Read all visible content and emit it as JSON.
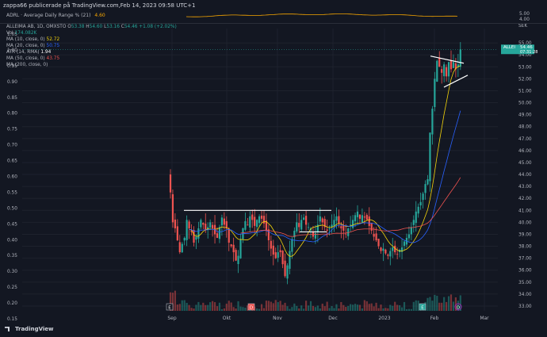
{
  "header": {
    "text": "zappa66 publicerade på TradingView.com,Feb 14, 2023 09:58 UTC+1"
  },
  "adr": {
    "label": "ADRL · Average Daily Range % (21)",
    "value": "4.60",
    "axis_ticks": [
      "5.00",
      "4.00"
    ]
  },
  "legend": {
    "title": "ALLEIMA AB, 1D, OMXSTO",
    "open_label": "O",
    "open": "53.38",
    "high_label": "H",
    "high": "54.60",
    "low_label": "L",
    "low": "53.16",
    "close_label": "C",
    "close": "54.46",
    "change": "+1.08 (+2.02%)",
    "vol_label": "Vol",
    "vol": "174.082K",
    "ma10_label": "MA (10, close, 0)",
    "ma10": "52.72",
    "ma20_label": "MA (20, close, 0)",
    "ma20": "50.75",
    "atr_label": "ATR (14, RMA)",
    "atr": "1.94",
    "ma50_label": "MA (50, close, 0)",
    "ma50": "43.75",
    "ma200_label": "MA (200, close, 0)"
  },
  "price_axis": {
    "currency": "SEK",
    "ticks": [
      "55.00",
      "54.00",
      "53.00",
      "52.00",
      "51.00",
      "50.00",
      "49.00",
      "48.00",
      "47.00",
      "46.00",
      "45.00",
      "44.00",
      "43.00",
      "42.00",
      "41.00",
      "40.00",
      "39.00",
      "38.00",
      "37.00",
      "36.00",
      "35.00",
      "34.00",
      "33.00"
    ],
    "last_symbol": "ALLEI",
    "last_price": "54.46",
    "countdown": "07:31:28"
  },
  "left_axis": {
    "ticks": [
      "1.05",
      "1.00",
      "0.95",
      "0.90",
      "0.85",
      "0.80",
      "0.75",
      "0.70",
      "0.65",
      "0.60",
      "0.55",
      "0.50",
      "0.45",
      "0.40",
      "0.35",
      "0.30",
      "0.25",
      "0.20",
      "0.15"
    ]
  },
  "time_axis": {
    "labels": [
      "Sep",
      "Okt",
      "Nov",
      "Dec",
      "2023",
      "Feb",
      "Mar"
    ]
  },
  "markers": [
    "E",
    "D",
    "E",
    "D"
  ],
  "colors": {
    "background": "#131722",
    "up": "#26a69a",
    "down": "#ef5350",
    "ma10": "#f5d50b",
    "ma20": "#2962ff",
    "ma50": "#ef5350",
    "adr": "#f7a600"
  },
  "footer": {
    "brand": "TradingView"
  },
  "chart_data": {
    "type": "candlestick",
    "symbol": "ALLEIMA AB",
    "interval": "1D",
    "ylim": [
      32.6,
      56.2
    ],
    "x_labels": [
      "Sep",
      "Okt",
      "Nov",
      "Dec",
      "2023",
      "Feb",
      "Mar"
    ],
    "closes": [
      42.5,
      40.0,
      39.5,
      38.5,
      37.5,
      38.2,
      38.7,
      40.2,
      39.5,
      39.2,
      38.3,
      38.8,
      39.5,
      40.2,
      39.8,
      39.4,
      39.6,
      40.0,
      39.5,
      39.0,
      38.7,
      39.6,
      40.4,
      39.8,
      39.5,
      38.3,
      38.0,
      37.5,
      36.8,
      37.2,
      38.6,
      39.5,
      40.1,
      39.8,
      40.5,
      40.2,
      39.7,
      40.2,
      40.5,
      40.3,
      39.9,
      39.3,
      38.5,
      37.8,
      37.3,
      37.0,
      37.5,
      37.5,
      36.5,
      35.5,
      36.4,
      37.6,
      38.6,
      39.3,
      40.0,
      39.6,
      40.2,
      40.4,
      39.8,
      39.6,
      39.5,
      38.8,
      39.1,
      39.8,
      40.5,
      40.0,
      39.6,
      39.3,
      39.5,
      39.8,
      40.2,
      40.5,
      39.9,
      39.5,
      39.3,
      39.0,
      39.5,
      39.8,
      40.2,
      40.6,
      40.9,
      40.3,
      40.6,
      40.4,
      40.2,
      39.7,
      39.3,
      38.8,
      38.5,
      38.0,
      37.6,
      37.8,
      37.4,
      37.2,
      37.6,
      37.9,
      37.5,
      37.3,
      37.7,
      37.9,
      38.4,
      38.7,
      39.0,
      39.6,
      40.2,
      40.9,
      41.3,
      41.7,
      42.4,
      43.2,
      43.6,
      47.5,
      49.5,
      52.0,
      53.5,
      53.0,
      52.5,
      53.2,
      52.2,
      53.4,
      52.8,
      53.4,
      52.8,
      53.2,
      54.46
    ],
    "ma10_last": 52.72,
    "ma20_last": 50.75,
    "ma50_last": 43.75,
    "triangle": {
      "upper": [
        [
          53.8,
          0
        ],
        [
          53.3,
          1
        ]
      ],
      "lower": [
        [
          51.3,
          0
        ],
        [
          52.3,
          1
        ]
      ]
    },
    "resistance": 41.0
  }
}
